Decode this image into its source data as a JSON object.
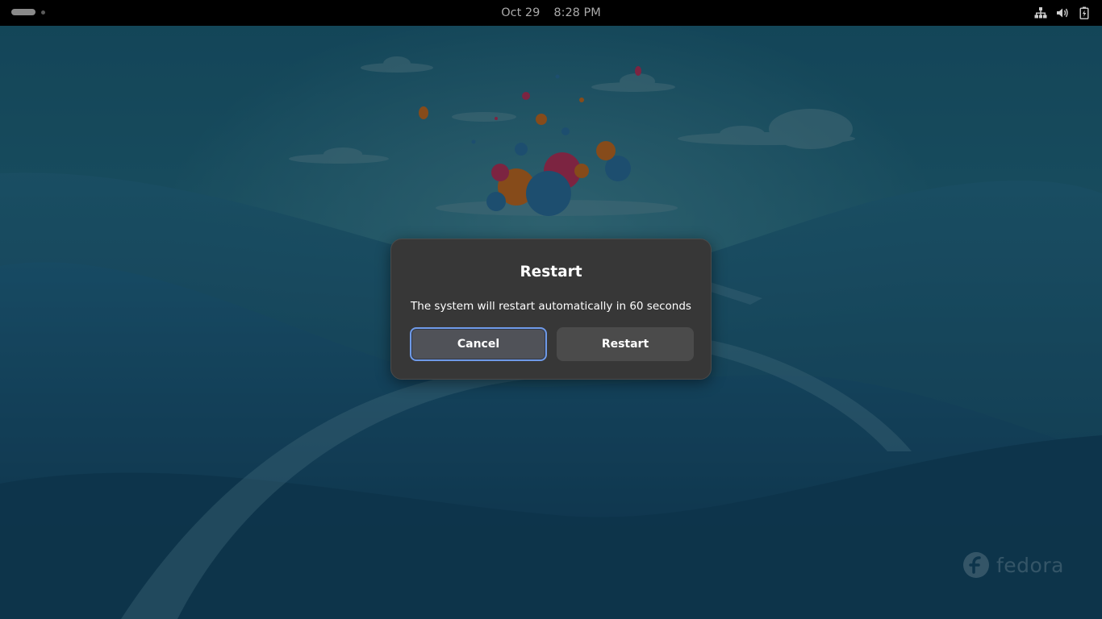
{
  "topbar": {
    "date": "Oct 29",
    "time": "8:28 PM",
    "indicators": [
      "network-wired-icon",
      "volume-icon",
      "battery-icon"
    ]
  },
  "dialog": {
    "title": "Restart",
    "message": "The system will restart automatically in 60 seconds",
    "cancel_label": "Cancel",
    "restart_label": "Restart",
    "countdown_seconds": 60,
    "focused_button": "Cancel"
  },
  "watermark": {
    "text": "fedora"
  },
  "colors": {
    "topbar": "#000000",
    "dialog_bg": "#373737",
    "button_bg": "#4b4b4b",
    "focus_ring": "#6f9ae8"
  }
}
